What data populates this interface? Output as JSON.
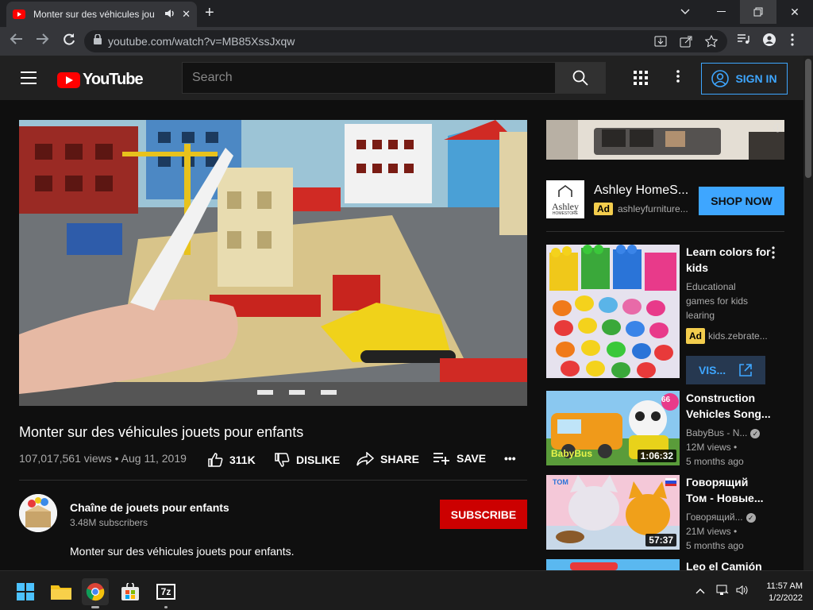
{
  "browser": {
    "tab_title": "Monter sur des véhicules jou",
    "url": "youtube.com/watch?v=MB85XssJxqw"
  },
  "header": {
    "logo_text": "YouTube",
    "search_placeholder": "Search",
    "signin_label": "SIGN IN"
  },
  "video": {
    "title": "Monter sur des véhicules jouets pour enfants",
    "meta": "107,017,561 views • Aug 11, 2019",
    "like_count": "311K",
    "dislike_label": "DISLIKE",
    "share_label": "SHARE",
    "save_label": "SAVE",
    "more_label": "•••"
  },
  "channel": {
    "name": "Chaîne de jouets pour enfants",
    "subscribers": "3.48M subscribers",
    "subscribe_label": "SUBSCRIBE",
    "description": "Monter sur des véhicules jouets pour enfants."
  },
  "ad": {
    "info_icon": "ⓘ",
    "logo_text": "Ashley",
    "logo_sub": "HOMESTORE",
    "title": "Ashley HomeS...",
    "badge": "Ad",
    "domain": "ashleyfurniture...",
    "cta": "SHOP NOW"
  },
  "sidebar": {
    "card": {
      "title_line1": "Learn colors for",
      "title_line2": "kids",
      "desc1": "Educational",
      "desc2": "games for kids",
      "desc3": "learing",
      "badge": "Ad",
      "domain": "kids.zebrate...",
      "visit_label": "VIS..."
    },
    "videos": [
      {
        "title_line1": "Construction",
        "title_line2": "Vehicles Song...",
        "channel": "BabyBus - N...",
        "views": "12M views •",
        "age": "5 months ago",
        "duration": "1:06:32",
        "thumb_text": "BabyBus",
        "thumb_badge": "66"
      },
      {
        "title_line1": "Говорящий",
        "title_line2": "Том - Новые...",
        "channel": "Говорящий...",
        "views": "21M views •",
        "age": "5 months ago",
        "duration": "57:37",
        "thumb_text": "TOM"
      },
      {
        "title_line1": "Leo el Camión"
      }
    ]
  },
  "taskbar": {
    "time": "11:57 AM",
    "date": "1/2/2022",
    "sevenzip_label": "7z"
  },
  "colors": {
    "youtube_red": "#ff0000",
    "subscribe_red": "#cc0000",
    "link_blue": "#3ea6ff",
    "ad_yellow": "#f3cd4d"
  }
}
